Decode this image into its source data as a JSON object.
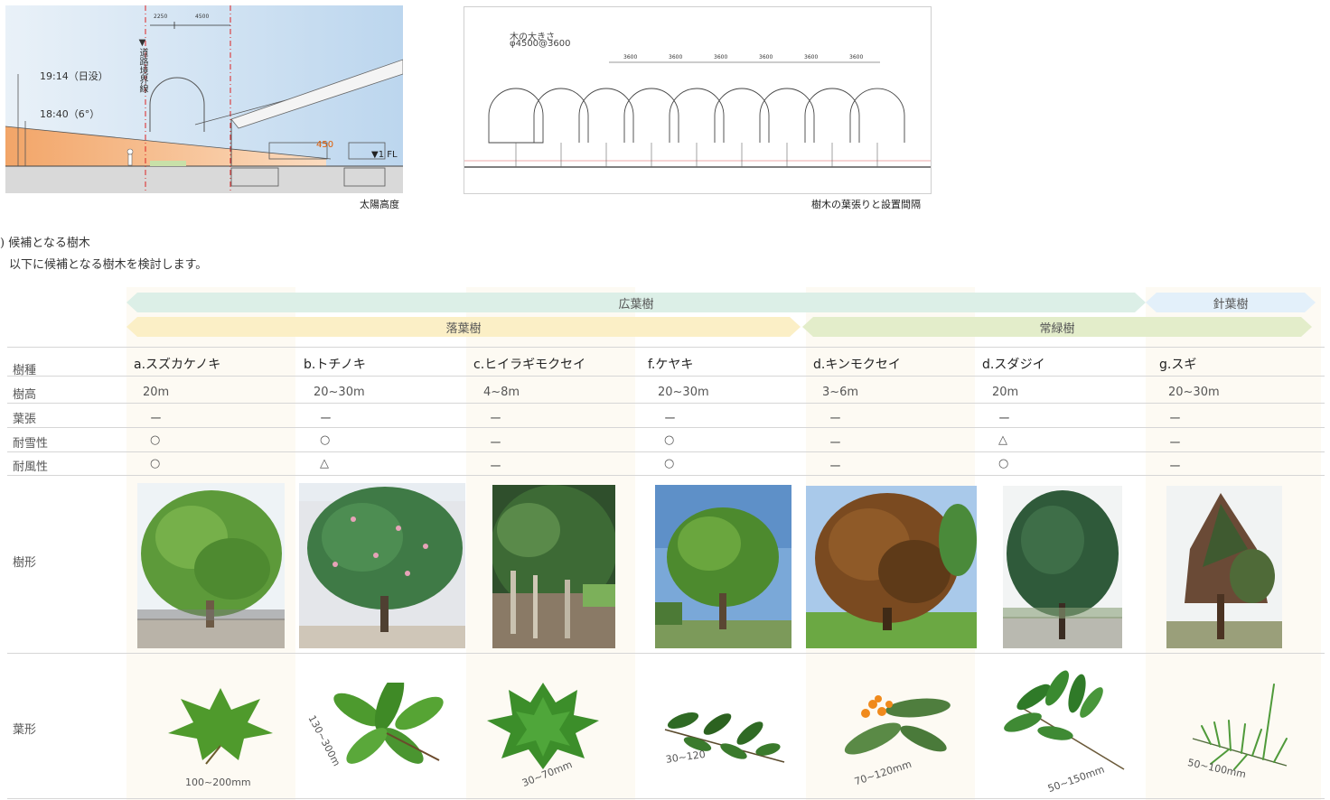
{
  "sun_diagram": {
    "dim_a": "2250",
    "dim_b": "4500",
    "boundary_label": "▼道路境界線",
    "sunset_label": "19:14（日没）",
    "angle_label": "18:40（6°）",
    "height_label": "450",
    "fl_label": "▼1 FL",
    "caption": "太陽高度"
  },
  "spacing_diagram": {
    "tree_size_label": "木の大きさ",
    "tree_size_value": "φ4500@3600",
    "dims": [
      "3600",
      "3600",
      "3600",
      "3600",
      "3600",
      "3600"
    ],
    "caption": "樹木の葉張りと設置間隔"
  },
  "section": {
    "heading": ") 候補となる樹木",
    "intro": "以下に候補となる樹木を検討します。"
  },
  "categories": {
    "broadleaf": "広葉樹",
    "conifer": "針葉樹",
    "deciduous": "落葉樹",
    "evergreen": "常緑樹"
  },
  "row_labels": {
    "species": "樹種",
    "height": "樹高",
    "spread": "葉張",
    "snow": "耐雪性",
    "wind": "耐風性",
    "shape": "樹形",
    "leaf": "葉形"
  },
  "trees": [
    {
      "name": "a.スズカケノキ",
      "height": "20m",
      "spread": "ー",
      "snow": "○",
      "wind": "○",
      "leaf_size": "100~200mm"
    },
    {
      "name": "b.トチノキ",
      "height": "20~30m",
      "spread": "ー",
      "snow": "○",
      "wind": "△",
      "leaf_size": "130~300m"
    },
    {
      "name": "c.ヒイラギモクセイ",
      "height": "4~8m",
      "spread": "ー",
      "snow": "ー",
      "wind": "ー",
      "leaf_size": "30~70mm"
    },
    {
      "name": "f.ケヤキ",
      "height": "20~30m",
      "spread": "ー",
      "snow": "○",
      "wind": "○",
      "leaf_size": "30~120"
    },
    {
      "name": "d.キンモクセイ",
      "height": "3~6m",
      "spread": "ー",
      "snow": "ー",
      "wind": "ー",
      "leaf_size": "70~120mm"
    },
    {
      "name": "d.スダジイ",
      "height": "20m",
      "spread": "ー",
      "snow": "△",
      "wind": "○",
      "leaf_size": "50~150mm"
    },
    {
      "name": "g.スギ",
      "height": "20~30m",
      "spread": "ー",
      "snow": "ー",
      "wind": "ー",
      "leaf_size": "50~100mm"
    }
  ]
}
